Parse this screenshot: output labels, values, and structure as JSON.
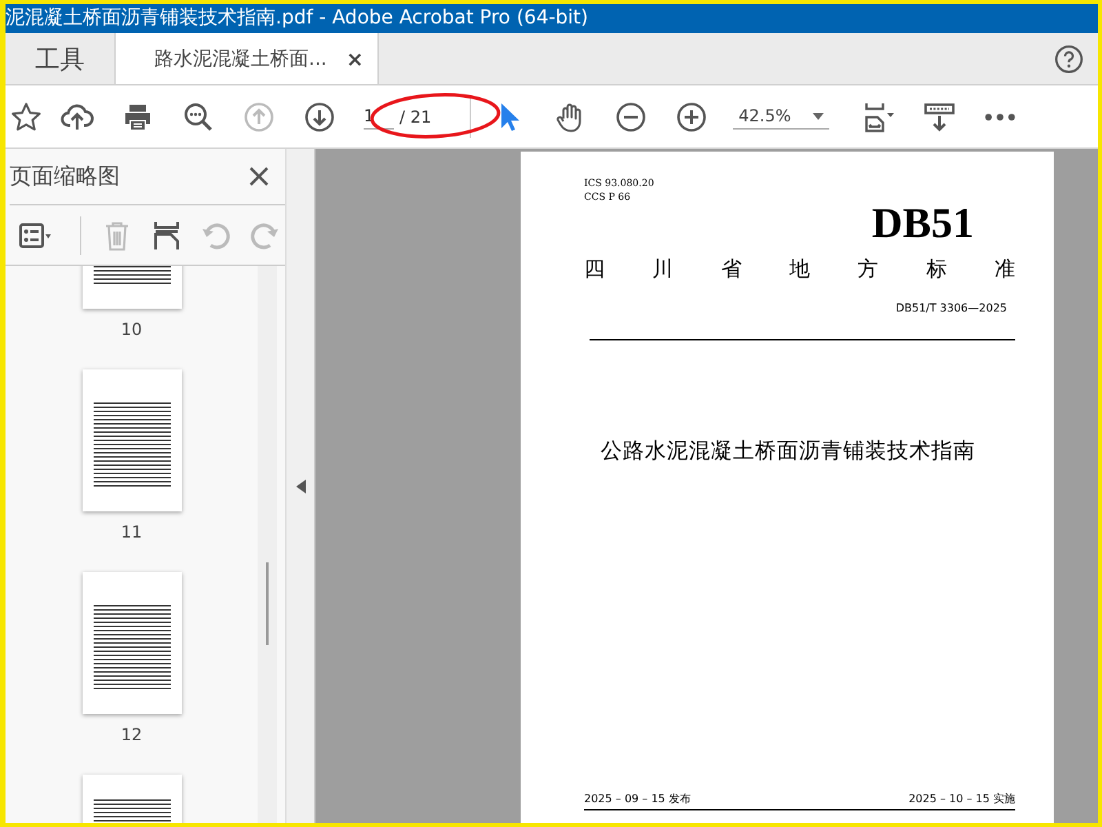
{
  "window": {
    "title": "泥混凝土桥面沥青铺装技术指南.pdf - Adobe Acrobat Pro (64-bit)"
  },
  "tabs": [
    {
      "label": "工具",
      "selected": false
    },
    {
      "label": "路水泥混凝土桥面...",
      "selected": true,
      "close": "×"
    }
  ],
  "toolbar": [
    {
      "kind": "star",
      "disabled": false
    },
    {
      "kind": "upload",
      "disabled": false
    },
    {
      "kind": "print",
      "disabled": false
    },
    {
      "kind": "zoom-search",
      "disabled": false
    },
    {
      "kind": "prev",
      "disabled": true
    },
    {
      "kind": "next",
      "disabled": false
    },
    {
      "kind": "page",
      "value": "1",
      "total": "/ 21"
    },
    {
      "kind": "select",
      "disabled": false,
      "selected": true
    },
    {
      "kind": "hand",
      "disabled": false,
      "selected": false
    },
    {
      "kind": "zoom-out",
      "disabled": false
    },
    {
      "kind": "zoom-in",
      "disabled": false
    },
    {
      "kind": "zoom",
      "value": "42.5%"
    },
    {
      "kind": "fit",
      "disabled": false
    },
    {
      "kind": "read",
      "disabled": false
    },
    {
      "kind": "more",
      "disabled": false
    }
  ],
  "sidebar": {
    "title": "页面缩略图",
    "tools": [
      {
        "kind": "options",
        "disabled": false
      },
      {
        "kind": "trash",
        "disabled": true
      },
      {
        "kind": "insert",
        "disabled": false
      },
      {
        "kind": "undo",
        "disabled": true
      },
      {
        "kind": "redo",
        "disabled": true
      }
    ],
    "thumbnails": [
      {
        "label": "10"
      },
      {
        "label": "11"
      },
      {
        "label": "12"
      }
    ]
  },
  "document": {
    "ics": "ICS  93.080.20",
    "ccs": "CCS  P 66",
    "code": "DB51",
    "category": "四川省地方标准",
    "number": "DB51/T 3306—2025",
    "title": "公路水泥混凝土桥面沥青铺装技术指南",
    "issued": "2025 – 09 – 15 发布",
    "effective": "2025 – 10 – 15 实施"
  }
}
